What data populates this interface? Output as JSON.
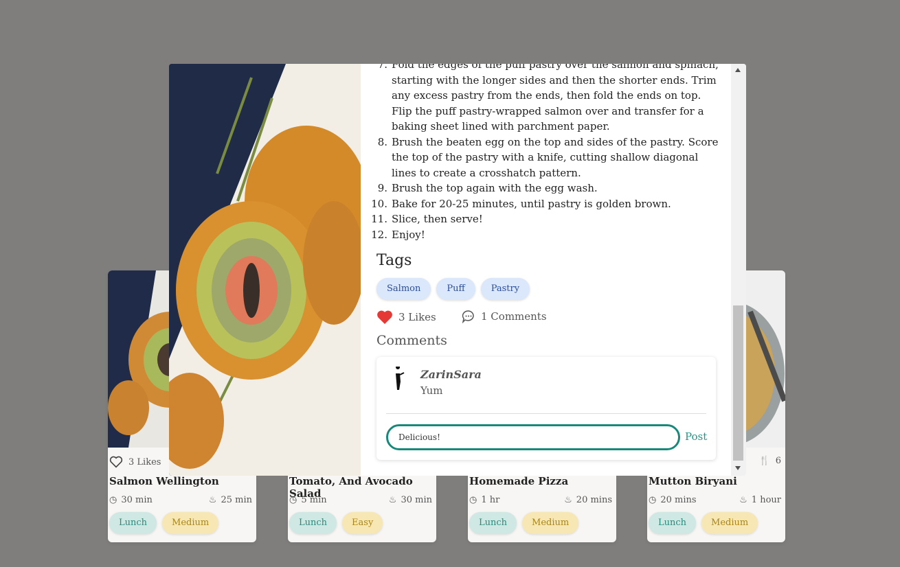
{
  "cards": [
    {
      "likes": "3 Likes",
      "serves": "",
      "title": "Salmon Wellington",
      "prep": "30 min",
      "cook": "25 min",
      "meal": "Lunch",
      "difficulty": "Medium",
      "difficulty_color": "#f7e7b5"
    },
    {
      "likes": "",
      "serves": "",
      "title": "Tomato, And Avocado Salad",
      "prep": "5 min",
      "cook": "30 min",
      "meal": "Lunch",
      "difficulty": "Easy",
      "difficulty_color": "#f7e7b5"
    },
    {
      "likes": "",
      "serves": "",
      "title": "Homemade Pizza",
      "prep": "1 hr",
      "cook": "20 mins",
      "meal": "Lunch",
      "difficulty": "Medium",
      "difficulty_color": "#f7e7b5"
    },
    {
      "likes": "",
      "serves": "6",
      "title": "Mutton Biryani",
      "prep": "20 mins",
      "cook": "1 hour",
      "meal": "Lunch",
      "difficulty": "Medium",
      "difficulty_color": "#f7e7b5"
    }
  ],
  "modal": {
    "steps": [
      {
        "n": "7.",
        "text": "Fold the edges of the puff pastry over the salmon and spinach, starting with the longer sides and then the shorter ends. Trim any excess pastry from the ends, then fold the ends on top. Flip the puff pastry-wrapped salmon over and transfer for a baking sheet lined with parchment paper."
      },
      {
        "n": "8.",
        "text": "Brush the beaten egg on the top and sides of the pastry. Score the top of the pastry with a knife, cutting shallow diagonal lines to create a crosshatch pattern."
      },
      {
        "n": "9.",
        "text": "Brush the top again with the egg wash."
      },
      {
        "n": "10.",
        "text": "Bake for 20-25 minutes, until pastry is golden brown."
      },
      {
        "n": "11.",
        "text": "Slice, then serve!"
      },
      {
        "n": "12.",
        "text": "Enjoy!"
      }
    ],
    "tags_heading": "Tags",
    "tags": [
      "Salmon",
      "Puff",
      "Pastry"
    ],
    "likes": "3 Likes",
    "comments_count": "1 Comments",
    "comments_heading": "Comments",
    "comment": {
      "user": "ZarinSara",
      "text": "Yum"
    },
    "comment_input": {
      "value": "Delicious!",
      "placeholder": ""
    },
    "post_label": "Post"
  },
  "colors": {
    "accent": "#17897a",
    "heart": "#e53935",
    "tag_bg": "#dbe7fb",
    "overlay": "#7f7e7d"
  }
}
